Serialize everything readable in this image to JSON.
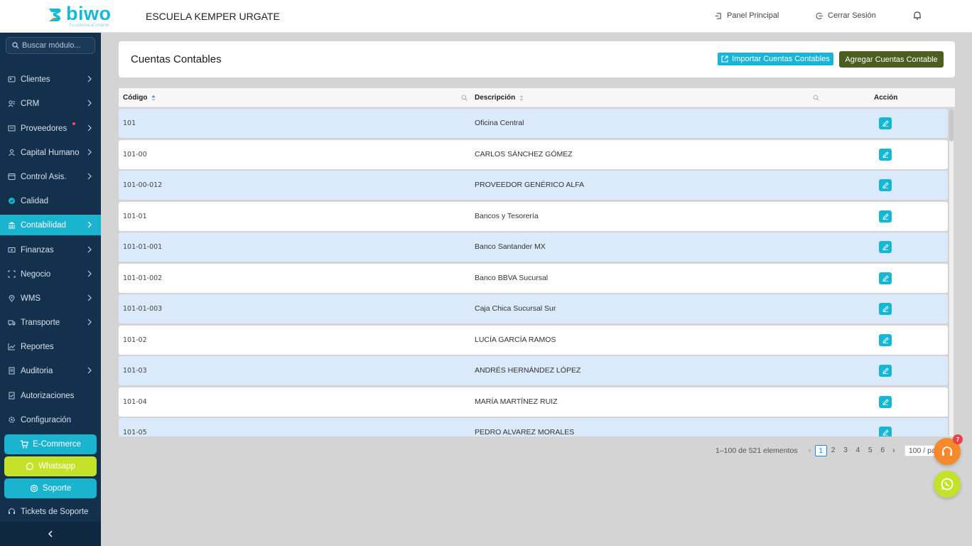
{
  "app": {
    "logo_text": "biwo",
    "logo_tagline": "Tu sistema al volante",
    "company": "ESCUELA KEMPER URGATE"
  },
  "topnav": {
    "panel": "Panel Principal",
    "logout": "Cerrar Sesión",
    "bell_icon": "bell-icon"
  },
  "sidebar": {
    "search_placeholder": "Buscar módulo...",
    "items": [
      {
        "label": "Clientes",
        "icon": "clients-icon",
        "chevron": true
      },
      {
        "label": "CRM",
        "icon": "crm-icon",
        "chevron": true
      },
      {
        "label": "Proveedores",
        "icon": "suppliers-icon",
        "chevron": true,
        "dot": true
      },
      {
        "label": "Capital Humano",
        "icon": "people-icon",
        "chevron": true
      },
      {
        "label": "Control Asis.",
        "icon": "clock-icon",
        "chevron": true
      },
      {
        "label": "Calidad",
        "icon": "quality-icon",
        "chevron": false
      },
      {
        "label": "Contabilidad",
        "icon": "bank-icon",
        "chevron": true,
        "active": true
      },
      {
        "label": "Finanzas",
        "icon": "finance-icon",
        "chevron": true
      },
      {
        "label": "Negocio",
        "icon": "business-icon",
        "chevron": true
      },
      {
        "label": "WMS",
        "icon": "location-icon",
        "chevron": true
      },
      {
        "label": "Transporte",
        "icon": "truck-icon",
        "chevron": true
      },
      {
        "label": "Reportes",
        "icon": "chart-icon",
        "chevron": false
      },
      {
        "label": "Auditoria",
        "icon": "audit-icon",
        "chevron": true
      },
      {
        "label": "Autorizaciones",
        "icon": "auth-icon",
        "chevron": false
      },
      {
        "label": "Configuración",
        "icon": "gear-icon",
        "chevron": false
      }
    ],
    "ecommerce": "E-Commerce",
    "whatsapp": "Whatsapp",
    "soporte": "Soporte",
    "tickets": "Tickets de Soporte"
  },
  "page": {
    "title": "Cuentas Contables",
    "import_label": "Importar Cuentas Contables",
    "add_label": "Agregar Cuentas Contable"
  },
  "table": {
    "columns": {
      "code": "Código",
      "description": "Descripción",
      "action": "Acción"
    },
    "rows": [
      {
        "code": "101",
        "description": "Oficina Central"
      },
      {
        "code": "101-00",
        "description": "CARLOS SÁNCHEZ GÓMEZ"
      },
      {
        "code": "101-00-012",
        "description": "PROVEEDOR GENÉRICO ALFA"
      },
      {
        "code": "101-01",
        "description": "Bancos y Tesorería"
      },
      {
        "code": "101-01-001",
        "description": "Banco Santander MX"
      },
      {
        "code": "101-01-002",
        "description": "Banco BBVA Sucursal"
      },
      {
        "code": "101-01-003",
        "description": "Caja Chica Sucursal Sur"
      },
      {
        "code": "101-02",
        "description": "LUCÍA GARCÍA RAMOS"
      },
      {
        "code": "101-03",
        "description": "ANDRÉS HERNÁNDEZ LÓPEZ"
      },
      {
        "code": "101-04",
        "description": "MARÍA MARTÍNEZ RUIZ"
      },
      {
        "code": "101-05",
        "description": "PEDRO ALVAREZ MORALES"
      }
    ]
  },
  "pagination": {
    "total_text": "1–100 de 521 elementos",
    "pages": [
      "1",
      "2",
      "3",
      "4",
      "5",
      "6"
    ],
    "current": "1",
    "page_size": "100 / page"
  },
  "fab": {
    "support_badge": "7"
  },
  "colors": {
    "sidebar_bg": "#13304d",
    "accent": "#1ab4cf",
    "add_button": "#4d5e21",
    "whatsapp": "#c5e22a",
    "support_fab": "#f6892b",
    "row_alt": "#dbeafa"
  }
}
